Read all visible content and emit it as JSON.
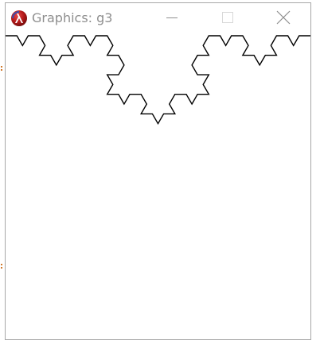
{
  "window": {
    "title": "Graphics: g3",
    "app_icon": "lisp-lambda-icon"
  },
  "titlebar_buttons": {
    "minimize_icon": "minimize-icon",
    "maximize_icon": "maximize-icon",
    "close_icon": "close-icon"
  },
  "canvas": {
    "figure": "koch-curve",
    "stroke_color": "#000000",
    "background": "#ffffff"
  },
  "colors": {
    "title_text": "#8e8e8e",
    "border": "#a7a7a7",
    "edge_marker": "#d0782a"
  }
}
